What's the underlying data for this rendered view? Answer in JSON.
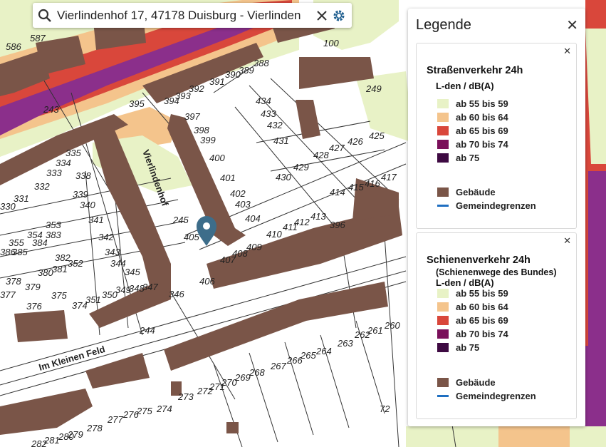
{
  "search": {
    "value": "Vierlindenhof 17, 47178 Duisburg - Vierlinden",
    "search_icon": "search-icon",
    "clear_icon": "close-icon",
    "settings_icon": "gear-icon"
  },
  "colors": {
    "db55": "#e8f2c6",
    "db60": "#f4c48c",
    "db65": "#d9473b",
    "db70": "#7a0f5a",
    "db75": "#3e0a42",
    "building": "#7a5548",
    "boundary": "#1f6fc1",
    "road_high": "#8b2f8b"
  },
  "legend": {
    "title": "Legende",
    "close_icon": "close-icon",
    "road": {
      "title": "Straßenverkehr 24h",
      "unit": "L-den / dB(A)",
      "classes": [
        "ab 55 bis 59",
        "ab 60 bis 64",
        "ab 65 bis 69",
        "ab 70 bis 74",
        "ab 75"
      ],
      "building": "Gebäude",
      "boundary": "Gemeindegrenzen"
    },
    "rail": {
      "title": "Schienenverkehr 24h",
      "subtitle": "(Schienenwege des Bundes)",
      "unit": "L-den / dB(A)",
      "classes": [
        "ab 55 bis 59",
        "ab 60 bis 64",
        "ab 65 bis 69",
        "ab 70 bis 74",
        "ab 75"
      ],
      "building": "Gebäude",
      "boundary": "Gemeindegrenzen"
    }
  },
  "map": {
    "street_labels": [
      "Vierlindenhof",
      "Im Kleinen Feld"
    ],
    "house_numbers": [
      "586",
      "587",
      "100",
      "390",
      "389",
      "388",
      "392",
      "391",
      "393",
      "394",
      "395",
      "243",
      "249",
      "397",
      "434",
      "433",
      "432",
      "398",
      "399",
      "431",
      "426",
      "425",
      "428",
      "427",
      "400",
      "429",
      "430",
      "401",
      "417",
      "416",
      "415",
      "414",
      "402",
      "403",
      "404",
      "413",
      "412",
      "411",
      "410",
      "396",
      "409",
      "408",
      "407",
      "406",
      "405",
      "245",
      "335",
      "334",
      "333",
      "338",
      "332",
      "331",
      "330",
      "339",
      "340",
      "341",
      "342",
      "343",
      "344",
      "345",
      "349",
      "348",
      "347",
      "346",
      "355",
      "354",
      "353",
      "383",
      "384",
      "385",
      "386",
      "380",
      "381",
      "382",
      "352",
      "379",
      "378",
      "377",
      "375",
      "376",
      "374",
      "351",
      "350",
      "244",
      "262",
      "261",
      "260",
      "263",
      "264",
      "265",
      "266",
      "267",
      "268",
      "269",
      "270",
      "271",
      "272",
      "273",
      "274",
      "275",
      "276",
      "277",
      "278",
      "279",
      "280",
      "281",
      "282",
      "72"
    ]
  },
  "marker": "location-pin-icon"
}
